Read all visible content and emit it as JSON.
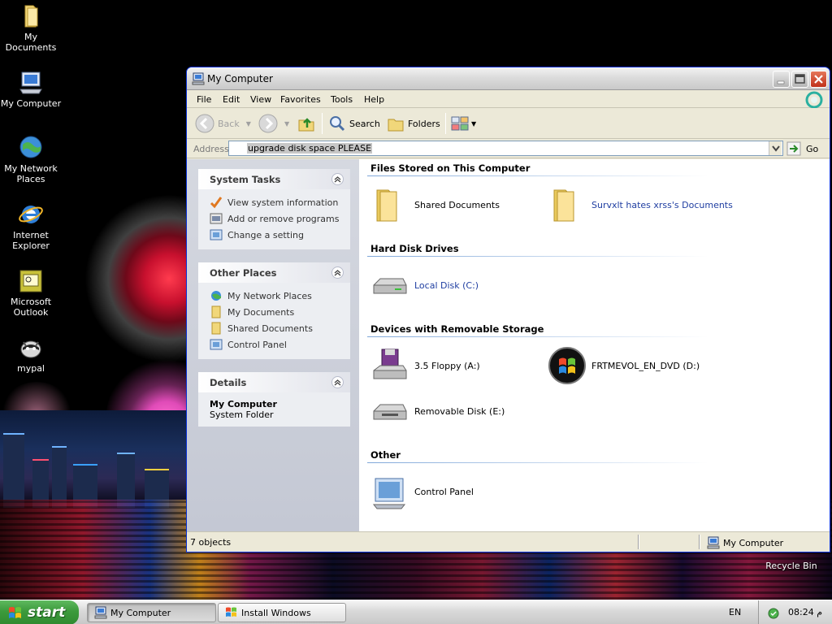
{
  "desktop": {
    "icons": [
      {
        "label": "My Documents",
        "icon": "folder-icon"
      },
      {
        "label": "My Computer",
        "icon": "computer-icon"
      },
      {
        "label": "My Network Places",
        "icon": "network-icon"
      },
      {
        "label": "Internet Explorer",
        "icon": "ie-icon"
      },
      {
        "label": "Microsoft Outlook",
        "icon": "outlook-icon"
      },
      {
        "label": "mypal",
        "icon": "mypal-icon"
      }
    ],
    "recycle_bin": "Recycle Bin"
  },
  "window": {
    "title": "My Computer",
    "menu": [
      "File",
      "Edit",
      "View",
      "Favorites",
      "Tools",
      "Help"
    ],
    "toolbar": {
      "back": "Back",
      "search": "Search",
      "folders": "Folders"
    },
    "address": {
      "label": "Address",
      "value": "upgrade disk space PLEASE",
      "go": "Go"
    },
    "task_pane": {
      "system_tasks": {
        "title": "System Tasks",
        "items": [
          "View system information",
          "Add or remove programs",
          "Change a setting"
        ]
      },
      "other_places": {
        "title": "Other Places",
        "items": [
          "My Network Places",
          "My Documents",
          "Shared Documents",
          "Control Panel"
        ]
      },
      "details": {
        "title": "Details",
        "name": "My Computer",
        "type": "System Folder"
      }
    },
    "sections": {
      "files": {
        "title": "Files Stored on This Computer",
        "items": [
          "Shared Documents",
          "Survxlt hates xrss's Documents"
        ]
      },
      "hard_disks": {
        "title": "Hard Disk Drives",
        "items": [
          "Local Disk (C:)"
        ]
      },
      "removable": {
        "title": "Devices with Removable Storage",
        "items": [
          "3.5 Floppy (A:)",
          "FRTMEVOL_EN_DVD (D:)",
          "Removable Disk (E:)"
        ]
      },
      "other": {
        "title": "Other",
        "items": [
          "Control Panel"
        ]
      }
    },
    "status": {
      "count": "7 objects",
      "location": "My Computer"
    }
  },
  "taskbar": {
    "start": "start",
    "tasks": [
      "My Computer",
      "Install Windows"
    ],
    "language": "EN",
    "clock": "08:24 م"
  },
  "colors": {
    "link_blue": "#1f3ea1",
    "start_green": "#3c9a3c",
    "titlebar_gray": "#dcdcdc"
  }
}
